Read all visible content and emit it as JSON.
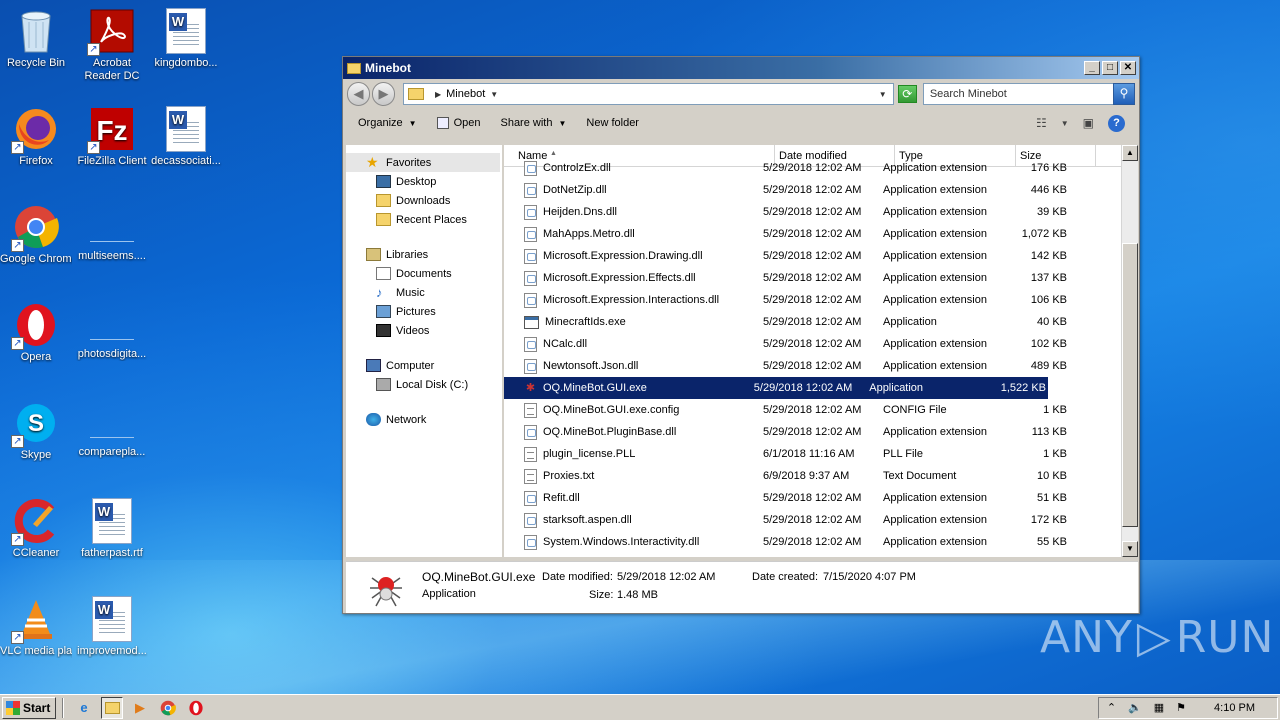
{
  "desktop": {
    "icons": [
      {
        "label": "Recycle Bin"
      },
      {
        "label": "Acrobat Reader DC"
      },
      {
        "label": "kingdombo..."
      },
      {
        "label": "Firefox"
      },
      {
        "label": "FileZilla Client"
      },
      {
        "label": "decassociati..."
      },
      {
        "label": "Google Chrome"
      },
      {
        "label": "multiseems...."
      },
      {
        "label": "Opera"
      },
      {
        "label": "photosdigita..."
      },
      {
        "label": "Skype"
      },
      {
        "label": "comparepla..."
      },
      {
        "label": "CCleaner"
      },
      {
        "label": "fatherpast.rtf"
      },
      {
        "label": "VLC media player"
      },
      {
        "label": "improvemod..."
      }
    ]
  },
  "window": {
    "title": "Minebot",
    "address_crumb": "Minebot",
    "search_placeholder": "Search Minebot",
    "commands": {
      "organize": "Organize",
      "open": "Open",
      "share_with": "Share with",
      "new_folder": "New folder"
    },
    "nav": {
      "favorites": "Favorites",
      "desktop": "Desktop",
      "downloads": "Downloads",
      "recent_places": "Recent Places",
      "libraries": "Libraries",
      "documents": "Documents",
      "music": "Music",
      "pictures": "Pictures",
      "videos": "Videos",
      "computer": "Computer",
      "local_disk": "Local Disk (C:)",
      "network": "Network"
    },
    "columns": {
      "name": "Name",
      "date": "Date modified",
      "type": "Type",
      "size": "Size"
    },
    "files": [
      {
        "name": "ControlzEx.dll",
        "date": "5/29/2018 12:02 AM",
        "type": "Application extension",
        "size": "176 KB",
        "icon": "dll"
      },
      {
        "name": "DotNetZip.dll",
        "date": "5/29/2018 12:02 AM",
        "type": "Application extension",
        "size": "446 KB",
        "icon": "dll"
      },
      {
        "name": "Heijden.Dns.dll",
        "date": "5/29/2018 12:02 AM",
        "type": "Application extension",
        "size": "39 KB",
        "icon": "dll"
      },
      {
        "name": "MahApps.Metro.dll",
        "date": "5/29/2018 12:02 AM",
        "type": "Application extension",
        "size": "1,072 KB",
        "icon": "dll"
      },
      {
        "name": "Microsoft.Expression.Drawing.dll",
        "date": "5/29/2018 12:02 AM",
        "type": "Application extension",
        "size": "142 KB",
        "icon": "dll"
      },
      {
        "name": "Microsoft.Expression.Effects.dll",
        "date": "5/29/2018 12:02 AM",
        "type": "Application extension",
        "size": "137 KB",
        "icon": "dll"
      },
      {
        "name": "Microsoft.Expression.Interactions.dll",
        "date": "5/29/2018 12:02 AM",
        "type": "Application extension",
        "size": "106 KB",
        "icon": "dll"
      },
      {
        "name": "MinecraftIds.exe",
        "date": "5/29/2018 12:02 AM",
        "type": "Application",
        "size": "40 KB",
        "icon": "exe"
      },
      {
        "name": "NCalc.dll",
        "date": "5/29/2018 12:02 AM",
        "type": "Application extension",
        "size": "102 KB",
        "icon": "dll"
      },
      {
        "name": "Newtonsoft.Json.dll",
        "date": "5/29/2018 12:02 AM",
        "type": "Application extension",
        "size": "489 KB",
        "icon": "dll"
      },
      {
        "name": "OQ.MineBot.GUI.exe",
        "date": "5/29/2018 12:02 AM",
        "type": "Application",
        "size": "1,522 KB",
        "icon": "spider",
        "selected": true
      },
      {
        "name": "OQ.MineBot.GUI.exe.config",
        "date": "5/29/2018 12:02 AM",
        "type": "CONFIG File",
        "size": "1 KB",
        "icon": "cfg"
      },
      {
        "name": "OQ.MineBot.PluginBase.dll",
        "date": "5/29/2018 12:02 AM",
        "type": "Application extension",
        "size": "113 KB",
        "icon": "dll"
      },
      {
        "name": "plugin_license.PLL",
        "date": "6/1/2018 11:16 AM",
        "type": "PLL File",
        "size": "1 KB",
        "icon": "cfg"
      },
      {
        "name": "Proxies.txt",
        "date": "6/9/2018 9:37 AM",
        "type": "Text Document",
        "size": "10 KB",
        "icon": "cfg"
      },
      {
        "name": "Refit.dll",
        "date": "5/29/2018 12:02 AM",
        "type": "Application extension",
        "size": "51 KB",
        "icon": "dll"
      },
      {
        "name": "starksoft.aspen.dll",
        "date": "5/29/2018 12:02 AM",
        "type": "Application extension",
        "size": "172 KB",
        "icon": "dll"
      },
      {
        "name": "System.Windows.Interactivity.dll",
        "date": "5/29/2018 12:02 AM",
        "type": "Application extension",
        "size": "55 KB",
        "icon": "dll"
      }
    ],
    "details": {
      "name": "OQ.MineBot.GUI.exe",
      "kind": "Application",
      "date_modified_label": "Date modified:",
      "date_modified": "5/29/2018 12:02 AM",
      "size_label": "Size:",
      "size": "1.48 MB",
      "date_created_label": "Date created:",
      "date_created": "7/15/2020 4:07 PM"
    }
  },
  "watermark": {
    "left": "ANY",
    "right": "RUN"
  },
  "taskbar": {
    "start_label": "Start",
    "clock": "4:10 PM"
  }
}
